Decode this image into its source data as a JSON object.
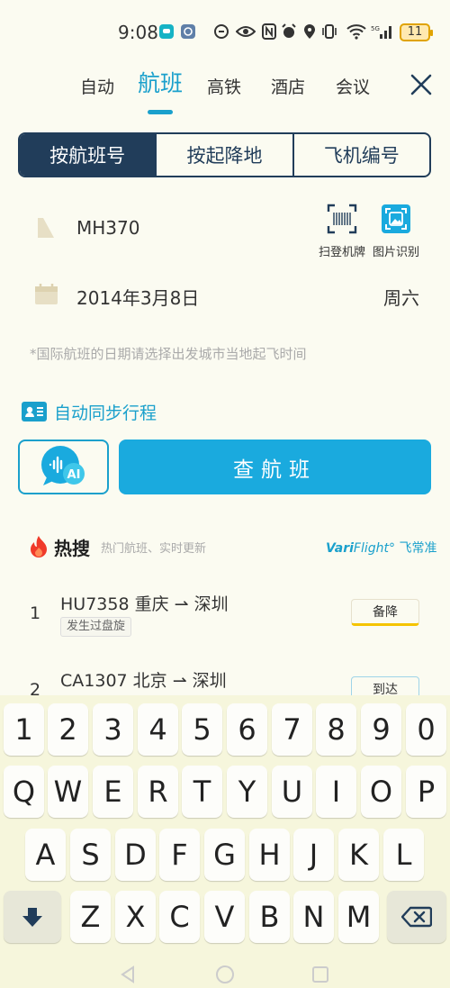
{
  "status_bar": {
    "time": "9:08",
    "battery": "11"
  },
  "top_tabs": [
    {
      "label": "自动"
    },
    {
      "label": "航班"
    },
    {
      "label": "高铁"
    },
    {
      "label": "酒店"
    },
    {
      "label": "会议"
    }
  ],
  "segments": [
    {
      "label": "按航班号"
    },
    {
      "label": "按起降地"
    },
    {
      "label": "飞机编号"
    }
  ],
  "form": {
    "flight_number": "MH370",
    "scan_label": "扫登机牌",
    "image_label": "图片识别",
    "date": "2014年3月8日",
    "weekday": "周六",
    "note": "*国际航班的日期请选择出发城市当地起飞时间"
  },
  "sync": {
    "label": "自动同步行程"
  },
  "ai_button": {
    "badge": "AI"
  },
  "search_button": {
    "label": "查航班"
  },
  "hot": {
    "title": "热搜",
    "subtitle": "热门航班、实时更新",
    "brand_prefix": "Vari",
    "brand_mid": "Flight",
    "brand_suffix": "° 飞常准",
    "items": [
      {
        "rank": "1",
        "route": "HU7358 重庆 ⇀ 深圳",
        "tag": "发生过盘旋",
        "status": "备降"
      },
      {
        "rank": "2",
        "route": "CA1307 北京 ⇀ 深圳",
        "tag": "",
        "status": "到达"
      }
    ]
  },
  "keyboard": {
    "row1": [
      "1",
      "2",
      "3",
      "4",
      "5",
      "6",
      "7",
      "8",
      "9",
      "0"
    ],
    "row2": [
      "Q",
      "W",
      "E",
      "R",
      "T",
      "Y",
      "U",
      "I",
      "O",
      "P"
    ],
    "row3": [
      "A",
      "S",
      "D",
      "F",
      "G",
      "H",
      "J",
      "K",
      "L"
    ],
    "row4": [
      "Z",
      "X",
      "C",
      "V",
      "B",
      "N",
      "M"
    ]
  },
  "colors": {
    "accent": "#1aa0cc",
    "navy": "#213d5a",
    "button": "#1aaade",
    "warning": "#f5c400"
  }
}
